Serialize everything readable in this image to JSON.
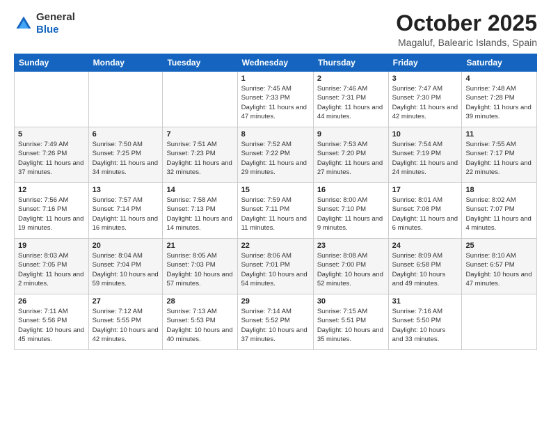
{
  "header": {
    "logo_general": "General",
    "logo_blue": "Blue",
    "month_title": "October 2025",
    "location": "Magaluf, Balearic Islands, Spain"
  },
  "weekdays": [
    "Sunday",
    "Monday",
    "Tuesday",
    "Wednesday",
    "Thursday",
    "Friday",
    "Saturday"
  ],
  "weeks": [
    [
      {
        "day": "",
        "sunrise": "",
        "sunset": "",
        "daylight": ""
      },
      {
        "day": "",
        "sunrise": "",
        "sunset": "",
        "daylight": ""
      },
      {
        "day": "",
        "sunrise": "",
        "sunset": "",
        "daylight": ""
      },
      {
        "day": "1",
        "sunrise": "Sunrise: 7:45 AM",
        "sunset": "Sunset: 7:33 PM",
        "daylight": "Daylight: 11 hours and 47 minutes."
      },
      {
        "day": "2",
        "sunrise": "Sunrise: 7:46 AM",
        "sunset": "Sunset: 7:31 PM",
        "daylight": "Daylight: 11 hours and 44 minutes."
      },
      {
        "day": "3",
        "sunrise": "Sunrise: 7:47 AM",
        "sunset": "Sunset: 7:30 PM",
        "daylight": "Daylight: 11 hours and 42 minutes."
      },
      {
        "day": "4",
        "sunrise": "Sunrise: 7:48 AM",
        "sunset": "Sunset: 7:28 PM",
        "daylight": "Daylight: 11 hours and 39 minutes."
      }
    ],
    [
      {
        "day": "5",
        "sunrise": "Sunrise: 7:49 AM",
        "sunset": "Sunset: 7:26 PM",
        "daylight": "Daylight: 11 hours and 37 minutes."
      },
      {
        "day": "6",
        "sunrise": "Sunrise: 7:50 AM",
        "sunset": "Sunset: 7:25 PM",
        "daylight": "Daylight: 11 hours and 34 minutes."
      },
      {
        "day": "7",
        "sunrise": "Sunrise: 7:51 AM",
        "sunset": "Sunset: 7:23 PM",
        "daylight": "Daylight: 11 hours and 32 minutes."
      },
      {
        "day": "8",
        "sunrise": "Sunrise: 7:52 AM",
        "sunset": "Sunset: 7:22 PM",
        "daylight": "Daylight: 11 hours and 29 minutes."
      },
      {
        "day": "9",
        "sunrise": "Sunrise: 7:53 AM",
        "sunset": "Sunset: 7:20 PM",
        "daylight": "Daylight: 11 hours and 27 minutes."
      },
      {
        "day": "10",
        "sunrise": "Sunrise: 7:54 AM",
        "sunset": "Sunset: 7:19 PM",
        "daylight": "Daylight: 11 hours and 24 minutes."
      },
      {
        "day": "11",
        "sunrise": "Sunrise: 7:55 AM",
        "sunset": "Sunset: 7:17 PM",
        "daylight": "Daylight: 11 hours and 22 minutes."
      }
    ],
    [
      {
        "day": "12",
        "sunrise": "Sunrise: 7:56 AM",
        "sunset": "Sunset: 7:16 PM",
        "daylight": "Daylight: 11 hours and 19 minutes."
      },
      {
        "day": "13",
        "sunrise": "Sunrise: 7:57 AM",
        "sunset": "Sunset: 7:14 PM",
        "daylight": "Daylight: 11 hours and 16 minutes."
      },
      {
        "day": "14",
        "sunrise": "Sunrise: 7:58 AM",
        "sunset": "Sunset: 7:13 PM",
        "daylight": "Daylight: 11 hours and 14 minutes."
      },
      {
        "day": "15",
        "sunrise": "Sunrise: 7:59 AM",
        "sunset": "Sunset: 7:11 PM",
        "daylight": "Daylight: 11 hours and 11 minutes."
      },
      {
        "day": "16",
        "sunrise": "Sunrise: 8:00 AM",
        "sunset": "Sunset: 7:10 PM",
        "daylight": "Daylight: 11 hours and 9 minutes."
      },
      {
        "day": "17",
        "sunrise": "Sunrise: 8:01 AM",
        "sunset": "Sunset: 7:08 PM",
        "daylight": "Daylight: 11 hours and 6 minutes."
      },
      {
        "day": "18",
        "sunrise": "Sunrise: 8:02 AM",
        "sunset": "Sunset: 7:07 PM",
        "daylight": "Daylight: 11 hours and 4 minutes."
      }
    ],
    [
      {
        "day": "19",
        "sunrise": "Sunrise: 8:03 AM",
        "sunset": "Sunset: 7:05 PM",
        "daylight": "Daylight: 11 hours and 2 minutes."
      },
      {
        "day": "20",
        "sunrise": "Sunrise: 8:04 AM",
        "sunset": "Sunset: 7:04 PM",
        "daylight": "Daylight: 10 hours and 59 minutes."
      },
      {
        "day": "21",
        "sunrise": "Sunrise: 8:05 AM",
        "sunset": "Sunset: 7:03 PM",
        "daylight": "Daylight: 10 hours and 57 minutes."
      },
      {
        "day": "22",
        "sunrise": "Sunrise: 8:06 AM",
        "sunset": "Sunset: 7:01 PM",
        "daylight": "Daylight: 10 hours and 54 minutes."
      },
      {
        "day": "23",
        "sunrise": "Sunrise: 8:08 AM",
        "sunset": "Sunset: 7:00 PM",
        "daylight": "Daylight: 10 hours and 52 minutes."
      },
      {
        "day": "24",
        "sunrise": "Sunrise: 8:09 AM",
        "sunset": "Sunset: 6:58 PM",
        "daylight": "Daylight: 10 hours and 49 minutes."
      },
      {
        "day": "25",
        "sunrise": "Sunrise: 8:10 AM",
        "sunset": "Sunset: 6:57 PM",
        "daylight": "Daylight: 10 hours and 47 minutes."
      }
    ],
    [
      {
        "day": "26",
        "sunrise": "Sunrise: 7:11 AM",
        "sunset": "Sunset: 5:56 PM",
        "daylight": "Daylight: 10 hours and 45 minutes."
      },
      {
        "day": "27",
        "sunrise": "Sunrise: 7:12 AM",
        "sunset": "Sunset: 5:55 PM",
        "daylight": "Daylight: 10 hours and 42 minutes."
      },
      {
        "day": "28",
        "sunrise": "Sunrise: 7:13 AM",
        "sunset": "Sunset: 5:53 PM",
        "daylight": "Daylight: 10 hours and 40 minutes."
      },
      {
        "day": "29",
        "sunrise": "Sunrise: 7:14 AM",
        "sunset": "Sunset: 5:52 PM",
        "daylight": "Daylight: 10 hours and 37 minutes."
      },
      {
        "day": "30",
        "sunrise": "Sunrise: 7:15 AM",
        "sunset": "Sunset: 5:51 PM",
        "daylight": "Daylight: 10 hours and 35 minutes."
      },
      {
        "day": "31",
        "sunrise": "Sunrise: 7:16 AM",
        "sunset": "Sunset: 5:50 PM",
        "daylight": "Daylight: 10 hours and 33 minutes."
      },
      {
        "day": "",
        "sunrise": "",
        "sunset": "",
        "daylight": ""
      }
    ]
  ]
}
